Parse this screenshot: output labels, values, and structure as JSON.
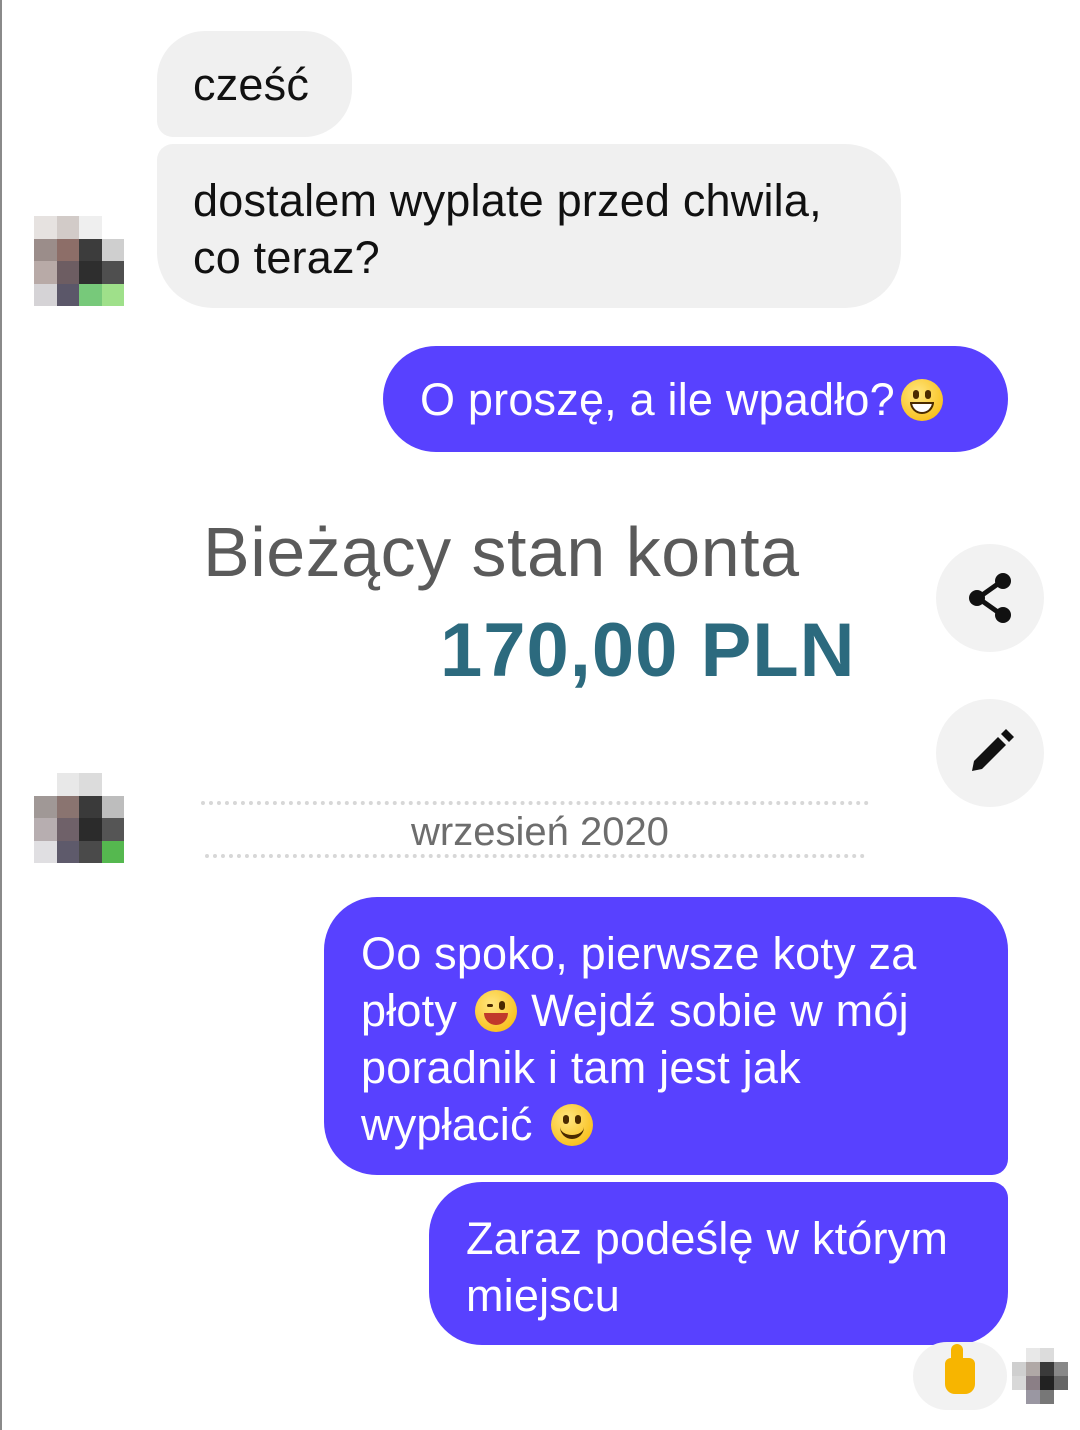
{
  "messages": {
    "incoming_1": "cześć",
    "incoming_2_line1": "dostalem wyplate przed chwila,",
    "incoming_2_line2": "co teraz?",
    "outgoing_1": "O proszę, a ile wpadło?",
    "outgoing_2_line1": "Oo spoko, pierwsze koty za",
    "outgoing_2_line2a": "płoty",
    "outgoing_2_line2b": "Wejdź sobie w mój",
    "outgoing_2_line3": "poradnik i tam jest jak",
    "outgoing_2_line4": "wypłacić",
    "outgoing_3_line1": "Zaraz podeślę w którym",
    "outgoing_3_line2": "miejscu"
  },
  "shared_image": {
    "title": "Bieżący stan konta",
    "amount": "170,00 PLN",
    "date": "wrzesień 2020"
  },
  "actions": {
    "share_icon": "share-icon",
    "edit_icon": "pencil-icon"
  },
  "reaction": {
    "emoji": "thumbs-up"
  },
  "colors": {
    "outgoing_bubble": "#5841ff",
    "incoming_bubble": "#f0f0f0",
    "amount": "#2c6a7e"
  }
}
